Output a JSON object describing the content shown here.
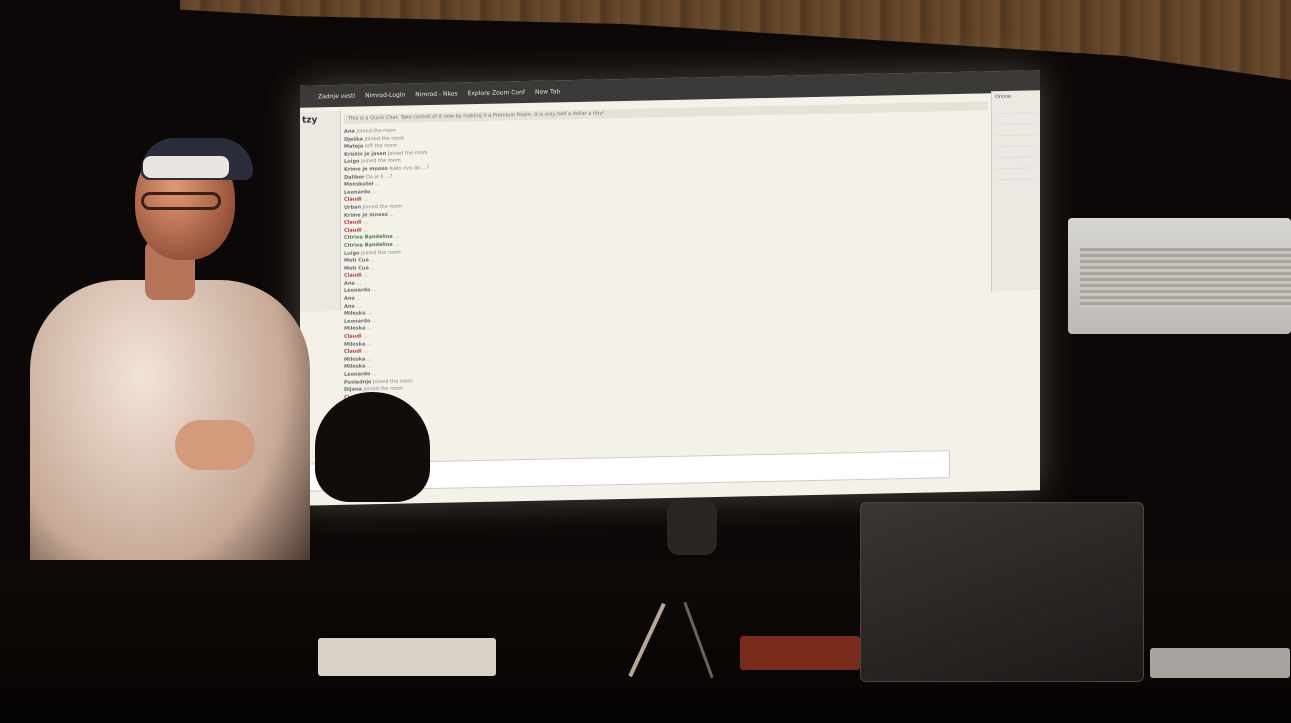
{
  "browser": {
    "tabs": [
      "Zadnje vesti",
      "Nimrod-Login",
      "Nimrod - Nkos",
      "Explore Zoom Conf",
      "New Tab"
    ]
  },
  "chat": {
    "notice": "This is a Quick Chat. Take control of it now by making it a Premium Room. It is only half a dollar a day!",
    "lines": [
      {
        "user": "Ana",
        "text": "Joined the room"
      },
      {
        "user": "Dješka",
        "text": "Joined the room"
      },
      {
        "user": "Mateja",
        "text": "left the room"
      },
      {
        "user": "Kristin je jasen",
        "text": "Joined the room"
      },
      {
        "user": "Luigo",
        "text": "Joined the room"
      },
      {
        "user": "Krime je mnoso",
        "text": "Kako ovo da ...?"
      },
      {
        "user": "Dalibor",
        "text": "Da je li ...?"
      },
      {
        "user": "Monskutel",
        "text": "..."
      },
      {
        "user": "Leonardo",
        "text": "..."
      },
      {
        "user": "Claudi",
        "text": "..."
      },
      {
        "user": "Urban",
        "text": "Joined the room"
      },
      {
        "user": "Krime je mnoso",
        "text": "..."
      },
      {
        "user": "Claudi",
        "text": "..."
      },
      {
        "user": "Claudi",
        "text": "..."
      },
      {
        "user": "Citrina Bandelina",
        "text": "..."
      },
      {
        "user": "Citrina Bandelina",
        "text": "..."
      },
      {
        "user": "Luigo",
        "text": "Joined the room"
      },
      {
        "user": "Moti Cua",
        "text": "..."
      },
      {
        "user": "Moti Cua",
        "text": "..."
      },
      {
        "user": "Claudi",
        "text": "..."
      },
      {
        "user": "Ana",
        "text": "..."
      },
      {
        "user": "Leonardo",
        "text": "..."
      },
      {
        "user": "Ana",
        "text": "..."
      },
      {
        "user": "Ana",
        "text": "..."
      },
      {
        "user": "Mileska",
        "text": "..."
      },
      {
        "user": "Leonardo",
        "text": "..."
      },
      {
        "user": "Mileska",
        "text": "..."
      },
      {
        "user": "Claudi",
        "text": "..."
      },
      {
        "user": "Mileska",
        "text": "..."
      },
      {
        "user": "Claudi",
        "text": "..."
      },
      {
        "user": "Mileska",
        "text": "..."
      },
      {
        "user": "Mileska",
        "text": "..."
      },
      {
        "user": "Leonardo",
        "text": "..."
      },
      {
        "user": "Poslednje",
        "text": "Joined the room"
      },
      {
        "user": "Dijana",
        "text": "Joined the room"
      },
      {
        "user": "Claudi",
        "text": "..."
      }
    ]
  },
  "sidebar": {
    "logo": "tzy",
    "online_title": "Online"
  }
}
